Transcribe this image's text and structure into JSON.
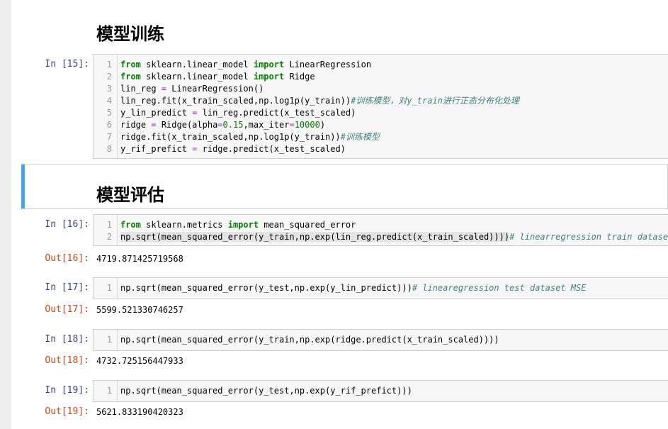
{
  "sections": {
    "training_title": "模型训练",
    "eval_title": "模型评估"
  },
  "cells": [
    {
      "prompt": "In [15]:",
      "lines": [
        "from sklearn.linear_model import LinearRegression",
        "from sklearn.linear_model import Ridge",
        "lin_reg = LinearRegression()",
        "lin_reg.fit(x_train_scaled,np.log1p(y_train))#训练模型，对y_train进行正态分布化处理",
        "y_lin_predict = lin_reg.predict(x_test_scaled)",
        "ridge = Ridge(alpha=0.15,max_iter=10000)",
        "ridge.fit(x_train_scaled,np.log1p(y_train))#训练模型",
        "y_rif_prefict = ridge.predict(x_test_scaled)"
      ]
    },
    {
      "prompt": "In [16]:",
      "lines": [
        "from sklearn.metrics import mean_squared_error",
        "np.sqrt(mean_squared_error(y_train,np.exp(lin_reg.predict(x_train_scaled))))# linearregression train dataset MS"
      ],
      "out_prompt": "Out[16]:",
      "output": "4719.871425719568"
    },
    {
      "prompt": "In [17]:",
      "lines": [
        "np.sqrt(mean_squared_error(y_test,np.exp(y_lin_predict)))# linearegression test dataset MSE"
      ],
      "out_prompt": "Out[17]:",
      "output": "5599.521330746257"
    },
    {
      "prompt": "In [18]:",
      "lines": [
        "np.sqrt(mean_squared_error(y_train,np.exp(ridge.predict(x_train_scaled))))"
      ],
      "out_prompt": "Out[18]:",
      "output": "4732.725156447933"
    },
    {
      "prompt": "In [19]:",
      "lines": [
        "np.sqrt(mean_squared_error(y_test,np.exp(y_rif_prefict)))"
      ],
      "out_prompt": "Out[19]:",
      "output": "5621.833190420323"
    }
  ],
  "line_numbers": [
    "1",
    "2",
    "3",
    "4",
    "5",
    "6",
    "7",
    "8"
  ],
  "colors": {
    "in_prompt": "#303f9f",
    "out_prompt": "#d84315",
    "keyword": "#008000",
    "comment": "#408080",
    "selection_bar": "#42a5f5"
  }
}
